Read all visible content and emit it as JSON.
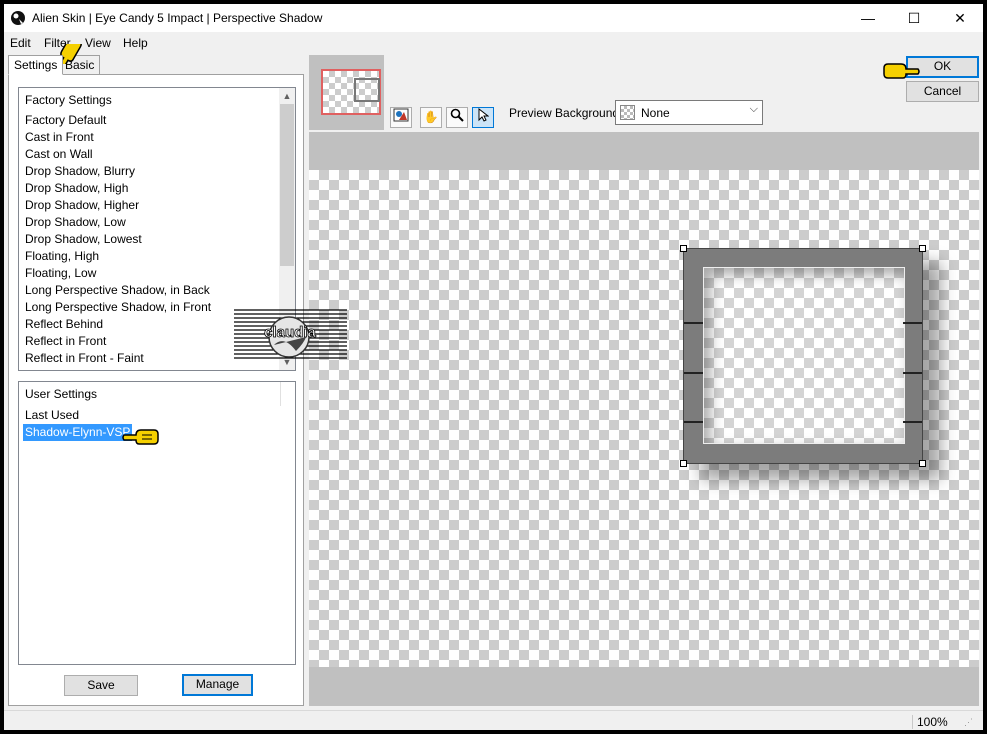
{
  "window": {
    "title": "Alien Skin | Eye Candy 5 Impact | Perspective Shadow",
    "minimize": "—",
    "maximize": "☐",
    "close": "✕"
  },
  "menu": [
    "Edit",
    "Filter",
    "View",
    "Help"
  ],
  "tabs": [
    "Settings",
    "Basic"
  ],
  "factory": {
    "header": "Factory Settings",
    "items": [
      "Factory Default",
      "Cast in Front",
      "Cast on Wall",
      "Drop Shadow, Blurry",
      "Drop Shadow, High",
      "Drop Shadow, Higher",
      "Drop Shadow, Low",
      "Drop Shadow, Lowest",
      "Floating, High",
      "Floating, Low",
      "Long Perspective Shadow, in Back",
      "Long Perspective Shadow, in Front",
      "Reflect Behind",
      "Reflect in Front",
      "Reflect in Front - Faint"
    ]
  },
  "user": {
    "header": "User Settings",
    "items": [
      "Last Used",
      "Shadow-Elynn-VSP"
    ]
  },
  "buttons": {
    "save": "Save",
    "manage": "Manage",
    "ok": "OK",
    "cancel": "Cancel"
  },
  "preview": {
    "bg_label": "Preview Background:",
    "bg_value": "None"
  },
  "status": {
    "zoom": "100%"
  },
  "watermark": {
    "text": "claudia"
  },
  "colors": {
    "accent": "#0078d7",
    "selection": "#3399ff",
    "frame": "#7c7c7c",
    "pointer": "#f5d000"
  },
  "icons": [
    "app-icon",
    "preview-tool-icon",
    "hand-icon",
    "zoom-icon",
    "pointer-arrow-icon",
    "dropdown-arrow-icon",
    "scroll-up-icon",
    "scroll-down-icon",
    "hand-pointer-icon"
  ]
}
